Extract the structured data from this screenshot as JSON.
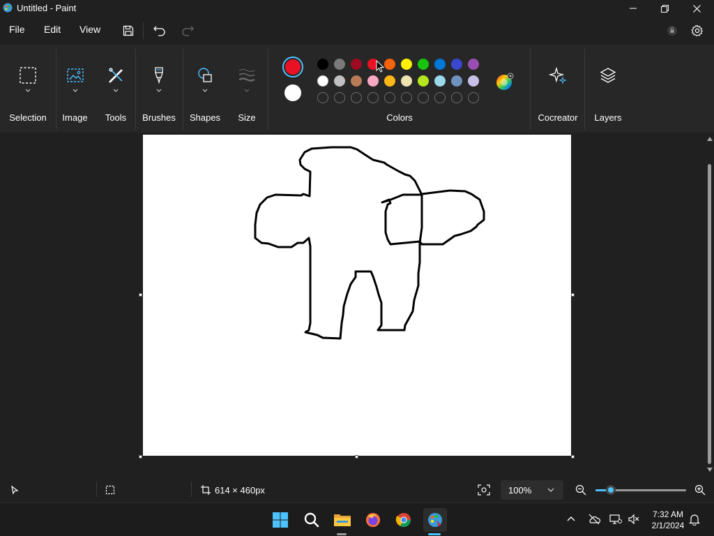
{
  "window": {
    "title": "Untitled - Paint"
  },
  "menu": {
    "file": "File",
    "edit": "Edit",
    "view": "View"
  },
  "ribbon": {
    "groups": [
      {
        "label": "Selection",
        "icon": "selection-icon"
      },
      {
        "label": "Image",
        "icon": "image-icon"
      },
      {
        "label": "Tools",
        "icon": "tools-icon"
      },
      {
        "label": "Brushes",
        "icon": "brush-icon"
      },
      {
        "label": "Shapes",
        "icon": "shapes-icon"
      },
      {
        "label": "Size",
        "icon": "size-icon"
      }
    ],
    "colors_label": "Colors",
    "cocreator_label": "Cocreator",
    "layers_label": "Layers",
    "primary_color": "#e81224",
    "secondary_color": "#ffffff",
    "palette_row1": [
      "#000000",
      "#7a7a7a",
      "#9d0c22",
      "#e81224",
      "#f7630c",
      "#fff100",
      "#16c60c",
      "#0078d7",
      "#3a48d0",
      "#9b4eb2"
    ],
    "palette_row2": [
      "#ffffff",
      "#c0c0c0",
      "#b97a57",
      "#f7a9c4",
      "#fdb719",
      "#efe4b0",
      "#b5e61d",
      "#99d9ea",
      "#7092be",
      "#c8bfe7"
    ]
  },
  "status": {
    "canvas_size": "614 × 460px",
    "zoom": "100%",
    "zoom_fraction": 0.17
  },
  "taskbar": {
    "time": "7:32 AM",
    "date": "2/1/2024"
  },
  "colors": {
    "accent": "#4cc2ff",
    "background": "#202020",
    "ribbon": "#272727"
  }
}
